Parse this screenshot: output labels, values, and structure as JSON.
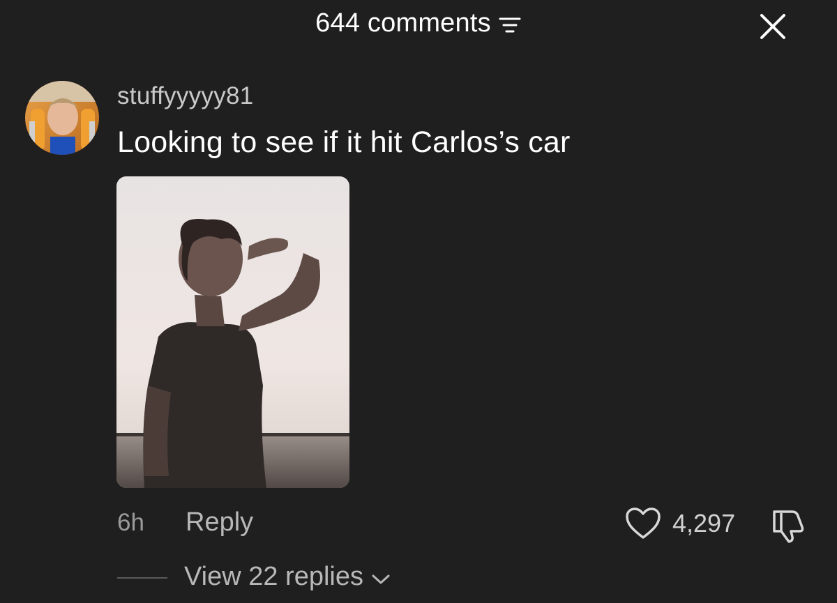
{
  "header": {
    "title": "644 comments",
    "sort_icon": "sort-lines-icon",
    "close_icon": "close-icon"
  },
  "comment": {
    "username": "stuffyyyyy81",
    "text": "Looking to see if it hit Carlos’s car",
    "avatar_icon": "avatar",
    "time": "6h",
    "reply_label": "Reply",
    "like_count": "4,297",
    "view_replies_label": "View 22 replies"
  },
  "colors": {
    "background": "#1f1f1f",
    "primary_text": "#ffffff",
    "secondary_text": "#b8b8b8",
    "muted_text": "#9b9b9b"
  }
}
